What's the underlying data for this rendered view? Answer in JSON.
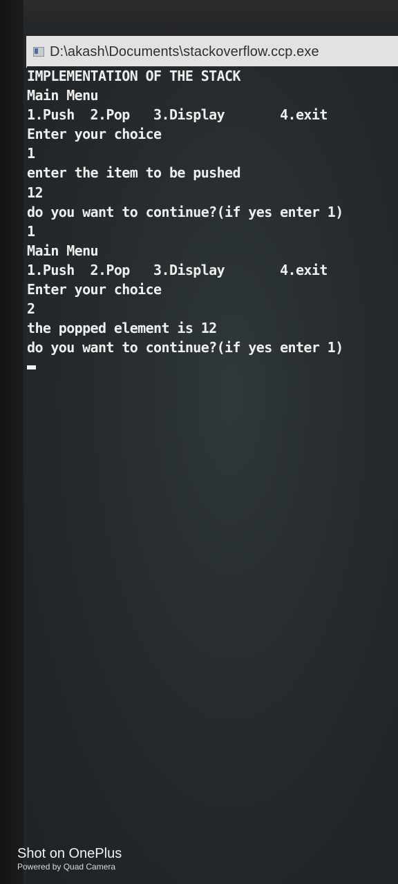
{
  "window": {
    "title": "D:\\akash\\Documents\\stackoverflow.ccp.exe",
    "icon": "console-app-icon"
  },
  "console": {
    "lines": [
      "IMPLEMENTATION OF THE STACK",
      "Main Menu",
      "1.Push  2.Pop   3.Display       4.exit",
      "Enter your choice",
      "1",
      "enter the item to be pushed",
      "12",
      "do you want to continue?(if yes enter 1)",
      "1",
      "Main Menu",
      "1.Push  2.Pop   3.Display       4.exit",
      "Enter your choice",
      "2",
      "the popped element is 12",
      "do you want to continue?(if yes enter 1)"
    ]
  },
  "watermark": {
    "main": "Shot on OnePlus",
    "sub": "Powered by Quad Camera"
  }
}
